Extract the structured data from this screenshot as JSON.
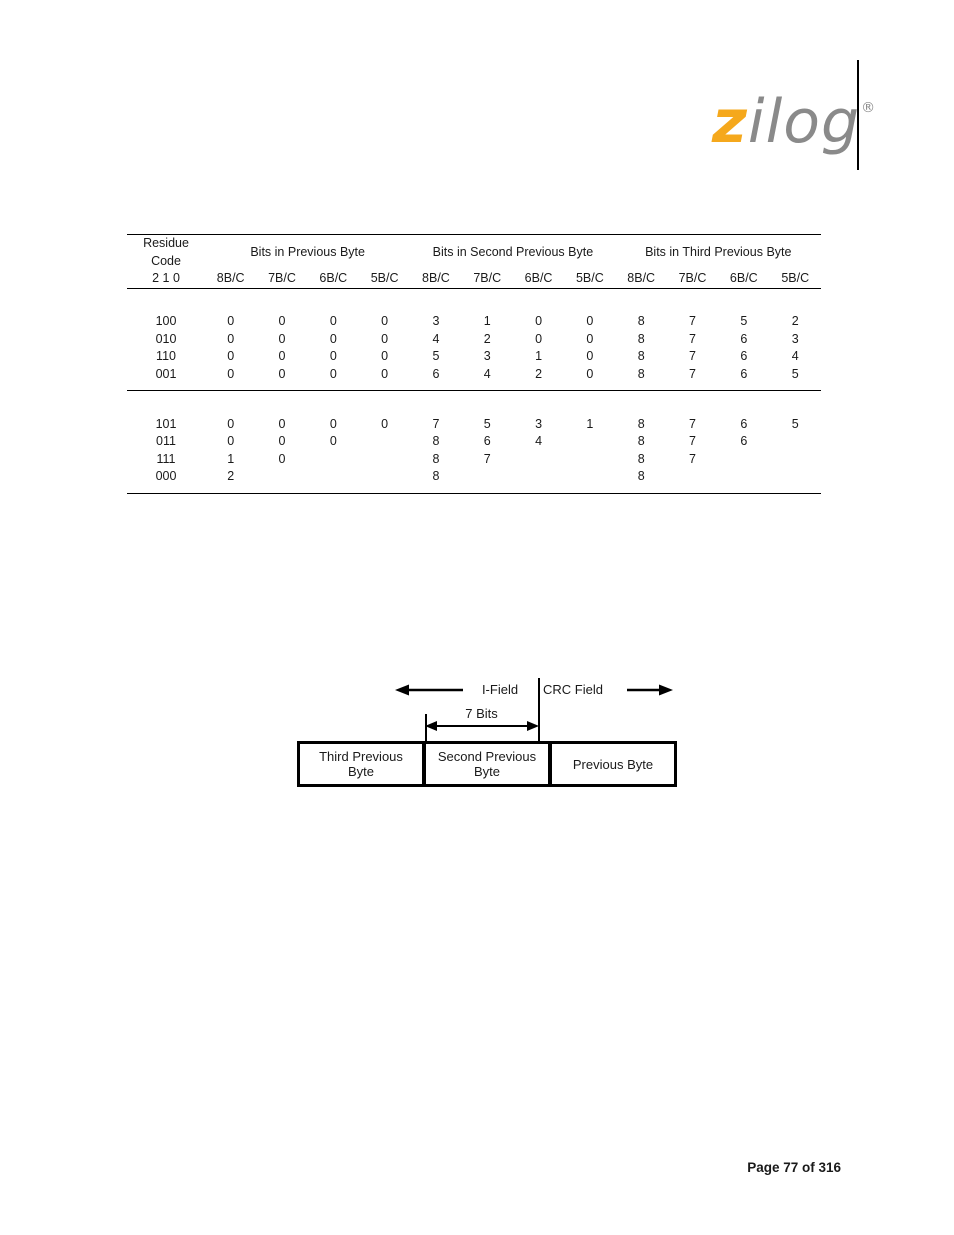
{
  "header": {
    "logo": {
      "first_letter": "z",
      "rest": "ilog",
      "registered_mark": "®",
      "color_first_letter": "#F5A81C",
      "color_rest": "#8A8A8A"
    }
  },
  "table": {
    "group_headers": [
      "Residue Code",
      "Bits in Previous Byte",
      "Bits in Second Previous Byte",
      "Bits in Third Previous Byte"
    ],
    "sub_headers": {
      "residue": "2 1 0",
      "previous_byte": [
        "8B/C",
        "7B/C",
        "6B/C",
        "5B/C"
      ],
      "second_previous_byte": [
        "8B/C",
        "7B/C",
        "6B/C",
        "5B/C"
      ],
      "third_previous_byte": [
        "8B/C",
        "7B/C",
        "6B/C",
        "5B/C"
      ]
    },
    "group_a": [
      {
        "code": "100",
        "prev": [
          "0",
          "0",
          "0",
          "0"
        ],
        "second": [
          "3",
          "1",
          "0",
          "0"
        ],
        "third": [
          "8",
          "7",
          "5",
          "2"
        ]
      },
      {
        "code": "010",
        "prev": [
          "0",
          "0",
          "0",
          "0"
        ],
        "second": [
          "4",
          "2",
          "0",
          "0"
        ],
        "third": [
          "8",
          "7",
          "6",
          "3"
        ]
      },
      {
        "code": "110",
        "prev": [
          "0",
          "0",
          "0",
          "0"
        ],
        "second": [
          "5",
          "3",
          "1",
          "0"
        ],
        "third": [
          "8",
          "7",
          "6",
          "4"
        ]
      },
      {
        "code": "001",
        "prev": [
          "0",
          "0",
          "0",
          "0"
        ],
        "second": [
          "6",
          "4",
          "2",
          "0"
        ],
        "third": [
          "8",
          "7",
          "6",
          "5"
        ]
      }
    ],
    "group_b": [
      {
        "code": "101",
        "prev": [
          "0",
          "0",
          "0",
          "0"
        ],
        "second": [
          "7",
          "5",
          "3",
          "1"
        ],
        "third": [
          "8",
          "7",
          "6",
          "5"
        ]
      },
      {
        "code": "011",
        "prev": [
          "0",
          "0",
          "0",
          ""
        ],
        "second": [
          "8",
          "6",
          "4",
          ""
        ],
        "third": [
          "8",
          "7",
          "6",
          ""
        ]
      },
      {
        "code": "111",
        "prev": [
          "1",
          "0",
          "",
          ""
        ],
        "second": [
          "8",
          "7",
          "",
          ""
        ],
        "third": [
          "8",
          "7",
          "",
          ""
        ]
      },
      {
        "code": "000",
        "prev": [
          "2",
          "",
          "",
          ""
        ],
        "second": [
          "8",
          "",
          "",
          ""
        ],
        "third": [
          "8",
          "",
          "",
          ""
        ]
      }
    ]
  },
  "diagram": {
    "i_field_label": "I-Field",
    "crc_field_label": "CRC Field",
    "bits_label": "7 Bits",
    "boxes": [
      "Third Previous\nByte",
      "Second Previous\nByte",
      "Previous Byte"
    ]
  },
  "footer": {
    "page_number": "Page 77 of 316"
  }
}
